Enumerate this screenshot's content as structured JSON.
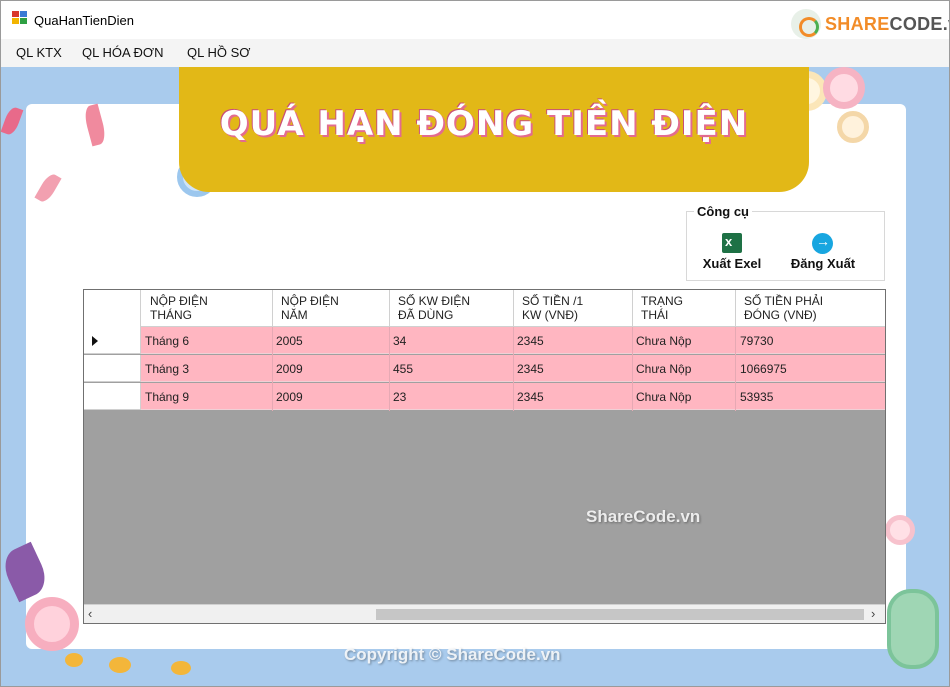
{
  "window": {
    "title": "QuaHanTienDien"
  },
  "logo": {
    "brand_main": "SHARE",
    "brand_rest": "CODE.vn"
  },
  "menu": [
    {
      "label": "QL KTX"
    },
    {
      "label": "QL HÓA ĐƠN"
    },
    {
      "label": "QL HỒ SƠ"
    }
  ],
  "banner": {
    "title": "QUÁ HẠN ĐÓNG TIỀN ĐIỆN"
  },
  "tools": {
    "legend": "Công cụ",
    "export_label": "Xuất Exel",
    "logout_label": "Đăng Xuất"
  },
  "grid": {
    "columns": [
      "NỘP ĐIỆN\nTHÁNG",
      "NỘP ĐIỆN\nNĂM",
      "SỐ KW ĐIỆN\nĐÃ DÙNG",
      "SỐ TIỀN /1\nKW (VNĐ)",
      "TRẠNG\nTHÁI",
      "SỐ TIỀN PHẢI\nĐÓNG (VNĐ)"
    ],
    "rows": [
      [
        "Tháng 6",
        "2005",
        "34",
        "2345",
        "Chưa Nộp",
        "79730"
      ],
      [
        "Tháng 3",
        "2009",
        "455",
        "2345",
        "Chưa Nộp",
        "1066975"
      ],
      [
        "Tháng 9",
        "2009",
        "23",
        "2345",
        "Chưa Nộp",
        "53935"
      ]
    ],
    "selected_row": 0
  },
  "watermarks": {
    "center": "ShareCode.vn",
    "bottom": "Copyright © ShareCode.vn"
  },
  "colors": {
    "banner": "#e2b817",
    "row_fill": "#ffb6c1",
    "background": "#a9cbed",
    "grid_empty": "#a0a0a0"
  }
}
